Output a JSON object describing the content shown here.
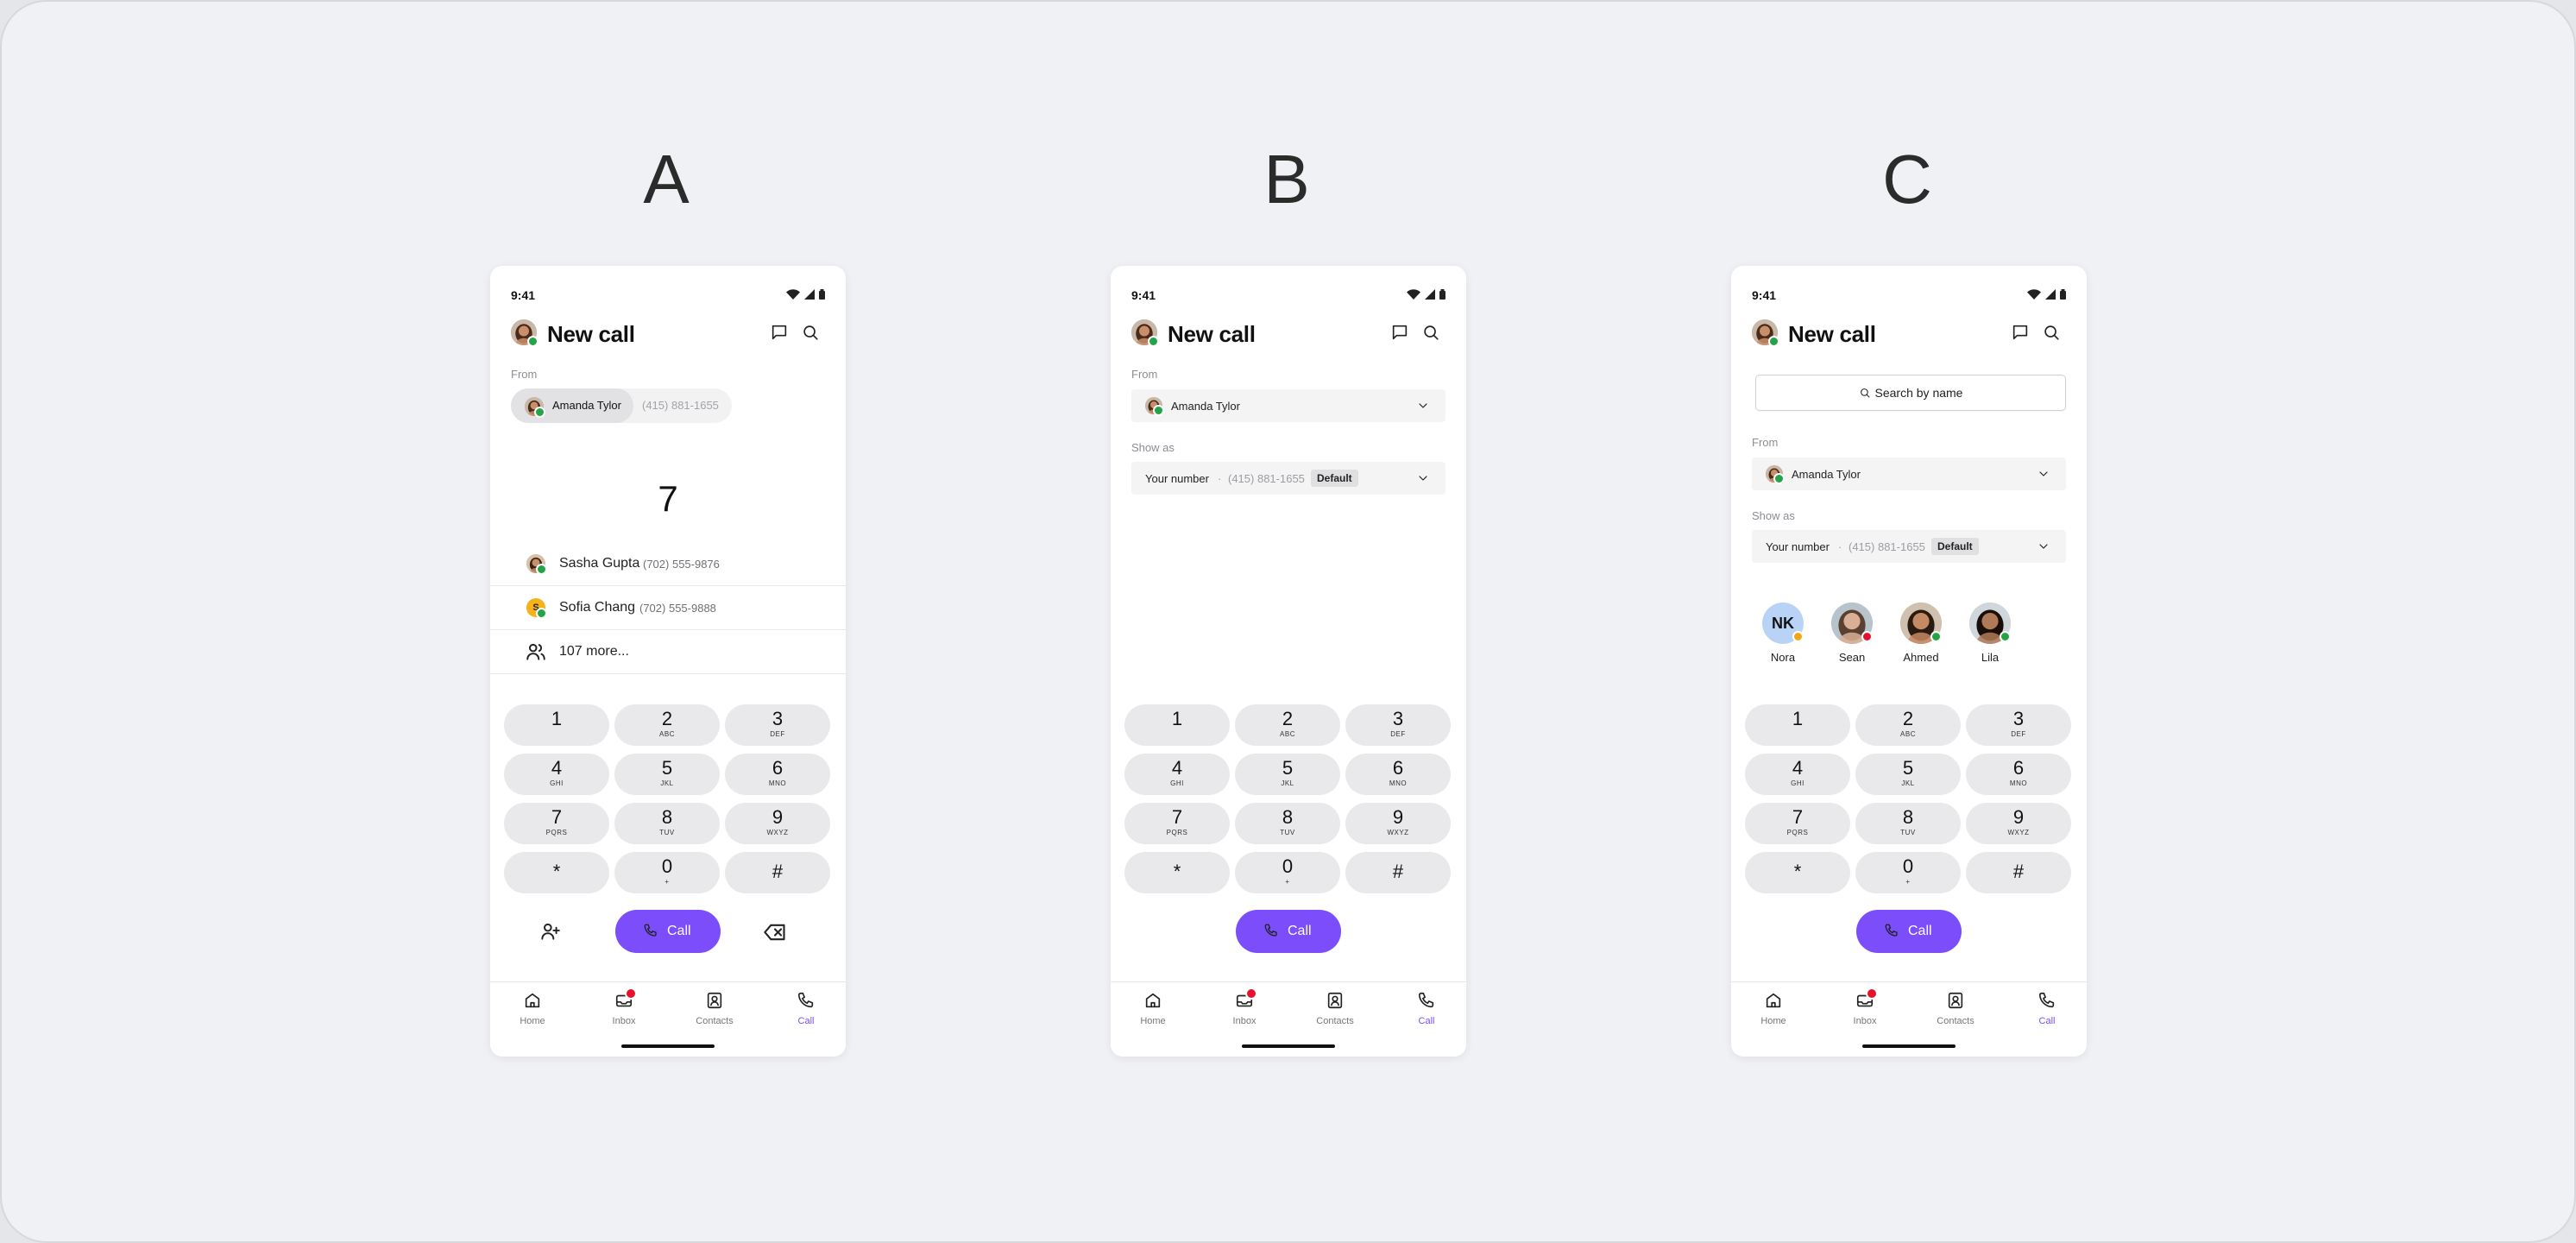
{
  "variants": [
    {
      "label": "A",
      "status_time": "9:41",
      "title": "New call",
      "from_label": "From",
      "from_name": "Amanda Tylor",
      "from_number": "(415) 881-1655",
      "typed": "7",
      "suggestions": [
        {
          "name": "Sasha Gupta",
          "number": "(702) 555-9876"
        },
        {
          "name": "Sofia Chang",
          "number": "(702) 555-9888",
          "initial": "S"
        }
      ],
      "more": "107 more...",
      "call_label": "Call"
    },
    {
      "label": "B",
      "status_time": "9:41",
      "title": "New call",
      "from_label": "From",
      "from_name": "Amanda Tylor",
      "show_as_label": "Show as",
      "your_number": "Your number",
      "separator": "·",
      "show_number": "(415) 881-1655",
      "default_badge": "Default",
      "call_label": "Call"
    },
    {
      "label": "C",
      "status_time": "9:41",
      "title": "New call",
      "search_placeholder": "Search by name",
      "from_label": "From",
      "from_name": "Amanda Tylor",
      "show_as_label": "Show as",
      "your_number": "Your number",
      "separator": "·",
      "show_number": "(415) 881-1655",
      "default_badge": "Default",
      "favorites": [
        {
          "name": "Nora",
          "initials": "NK"
        },
        {
          "name": "Sean"
        },
        {
          "name": "Ahmed"
        },
        {
          "name": "Lila"
        }
      ],
      "call_label": "Call"
    }
  ],
  "keypad": [
    {
      "digit": "1",
      "letters": ""
    },
    {
      "digit": "2",
      "letters": "ABC"
    },
    {
      "digit": "3",
      "letters": "DEF"
    },
    {
      "digit": "4",
      "letters": "GHI"
    },
    {
      "digit": "5",
      "letters": "JKL"
    },
    {
      "digit": "6",
      "letters": "MNO"
    },
    {
      "digit": "7",
      "letters": "PQRS"
    },
    {
      "digit": "8",
      "letters": "TUV"
    },
    {
      "digit": "9",
      "letters": "WXYZ"
    },
    {
      "digit": "*",
      "letters": ""
    },
    {
      "digit": "0",
      "letters": "+"
    },
    {
      "digit": "#",
      "letters": ""
    }
  ],
  "tabs": [
    "Home",
    "Inbox",
    "Contacts",
    "Call"
  ],
  "active_tab": "Call",
  "colors": {
    "accent": "#7c4dfa",
    "presence_online": "#22a447",
    "presence_busy": "#e5122d",
    "presence_away": "#f2a516",
    "notification": "#e5122d"
  },
  "icons": [
    "wifi-icon",
    "signal-icon",
    "battery-icon",
    "message-icon",
    "search-icon",
    "chevron-down-icon",
    "people-icon",
    "add-person-icon",
    "phone-icon",
    "backspace-icon",
    "home-icon",
    "inbox-icon",
    "contacts-icon",
    "call-icon"
  ]
}
